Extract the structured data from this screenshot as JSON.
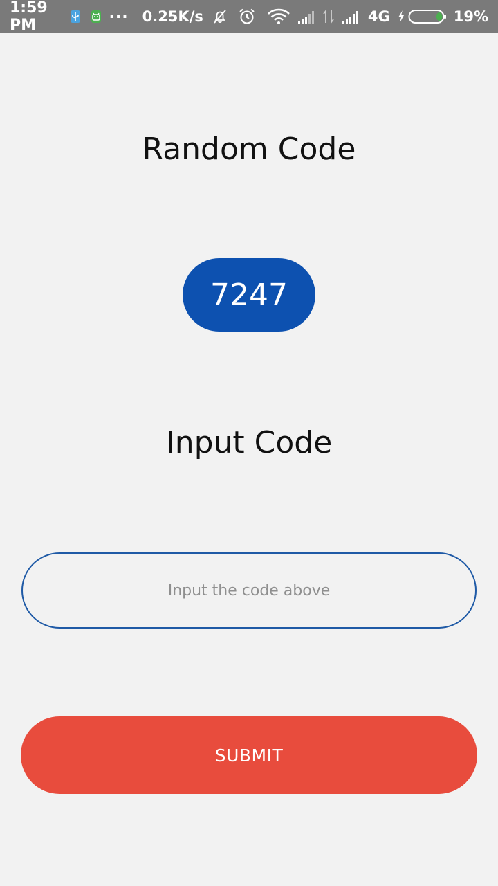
{
  "status_bar": {
    "time": "1:59 PM",
    "dots": "...",
    "net_speed": "0.25K/s",
    "network_type": "4G",
    "battery_percent": "19%",
    "icons": [
      "usb-debug-icon",
      "android-icon",
      "dnd-bell-icon",
      "alarm-icon",
      "wifi-icon",
      "signal-weak-icon",
      "data-arrows-icon",
      "signal-strong-icon",
      "charging-bolt-icon",
      "battery-icon"
    ],
    "battery_level": 0.19,
    "battery_fill_color": "#4caf50"
  },
  "main": {
    "random_title": "Random Code",
    "random_code": "7247",
    "input_title": "Input Code",
    "input": {
      "value": "",
      "placeholder": "Input the code above"
    },
    "submit_label": "SUBMIT"
  },
  "colors": {
    "background": "#f2f2f2",
    "status_bar": "#7a7a7a",
    "code_pill": "#0d51b0",
    "input_border": "#1f5aa6",
    "submit_button": "#e84c3d"
  }
}
